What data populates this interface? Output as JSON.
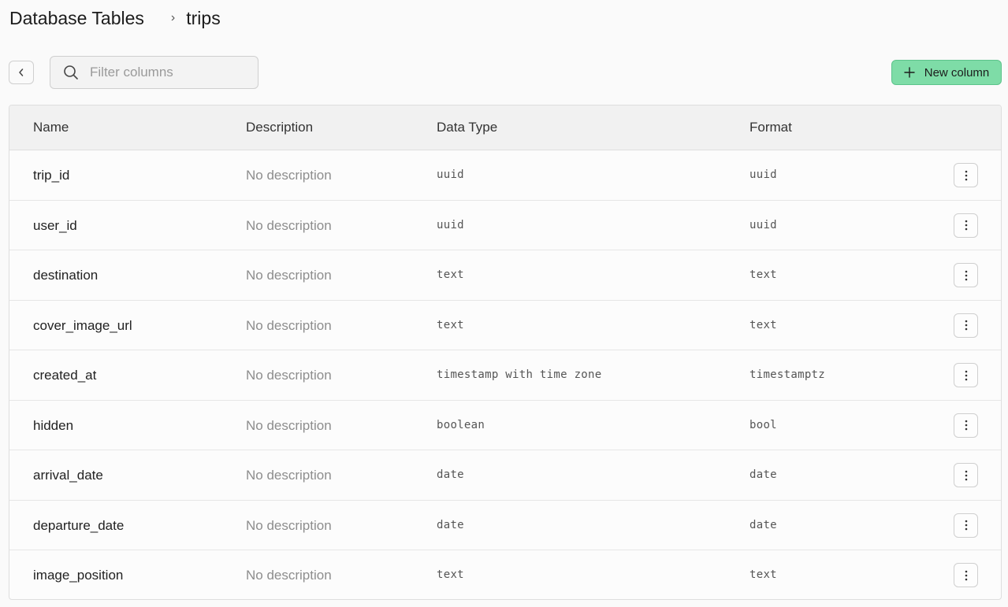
{
  "breadcrumb": {
    "root": "Database Tables",
    "separator": "›",
    "current": "trips"
  },
  "toolbar": {
    "search_placeholder": "Filter columns",
    "search_value": "",
    "new_column_label": "New column",
    "accent_color": "#7edca7"
  },
  "table": {
    "headers": {
      "name": "Name",
      "description": "Description",
      "data_type": "Data Type",
      "format": "Format"
    },
    "rows": [
      {
        "name": "trip_id",
        "description": "No description",
        "data_type": "uuid",
        "format": "uuid"
      },
      {
        "name": "user_id",
        "description": "No description",
        "data_type": "uuid",
        "format": "uuid"
      },
      {
        "name": "destination",
        "description": "No description",
        "data_type": "text",
        "format": "text"
      },
      {
        "name": "cover_image_url",
        "description": "No description",
        "data_type": "text",
        "format": "text"
      },
      {
        "name": "created_at",
        "description": "No description",
        "data_type": "timestamp with time zone",
        "format": "timestamptz"
      },
      {
        "name": "hidden",
        "description": "No description",
        "data_type": "boolean",
        "format": "bool"
      },
      {
        "name": "arrival_date",
        "description": "No description",
        "data_type": "date",
        "format": "date"
      },
      {
        "name": "departure_date",
        "description": "No description",
        "data_type": "date",
        "format": "date"
      },
      {
        "name": "image_position",
        "description": "No description",
        "data_type": "text",
        "format": "text"
      }
    ]
  },
  "icons": {
    "back": "chevron-left-icon",
    "search": "search-icon",
    "add": "plus-icon",
    "row_menu": "more-vertical-icon"
  }
}
